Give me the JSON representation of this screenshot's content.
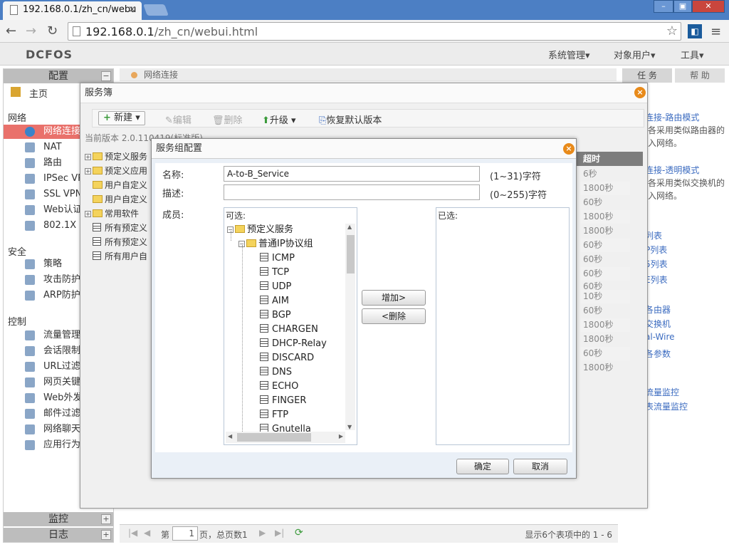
{
  "browser": {
    "tab_title": "192.168.0.1/zh_cn/webu",
    "tab_close": "×",
    "url_host": "192.168.0.1",
    "url_path": "/zh_cn/webui.html",
    "window_buttons": [
      "–",
      "▣",
      "✕"
    ]
  },
  "app": {
    "logo": "DCFOS",
    "top_menu": [
      "系统管理▾",
      "对象用户▾",
      "工具▾"
    ]
  },
  "sidebar": {
    "config_header": "配置",
    "home": "主页",
    "sections": {
      "network": "网络",
      "security": "安全",
      "control": "控制"
    },
    "network_items": [
      "网络连接",
      "NAT",
      "路由",
      "IPSec VPN",
      "SSL VPN",
      "Web认证",
      "802.1X"
    ],
    "security_items": [
      "策略",
      "攻击防护",
      "ARP防护"
    ],
    "control_items": [
      "流量管理",
      "会话限制",
      "URL过滤",
      "网页关键字",
      "Web外发",
      "邮件过滤",
      "网络聊天",
      "应用行为"
    ],
    "monitor_header": "监控",
    "log_header": "日志",
    "collapse_symbol": "−",
    "expand_symbol": "+"
  },
  "main": {
    "breadcrumb": "网络连接",
    "pager": {
      "prefix": "第",
      "page": "1",
      "suffix": "页，总页数1",
      "summary": "显示6个表项中的 1 - 6"
    }
  },
  "right_panel": {
    "tabs": [
      "任 务",
      "帮 助"
    ],
    "lines": [
      {
        "text": "连接-路由模式",
        "link": true
      },
      {
        "text": "各采用类似路由器的",
        "link": false
      },
      {
        "text": "入网络。",
        "link": false
      },
      {
        "text": "连接-透明模式",
        "link": true
      },
      {
        "text": "各采用类似交换机的",
        "link": false
      },
      {
        "text": "入网络。",
        "link": false
      },
      {
        "text": "列表",
        "link": true
      },
      {
        "text": "P列表",
        "link": true
      },
      {
        "text": "5列表",
        "link": true
      },
      {
        "text": "E列表",
        "link": true
      },
      {
        "text": "各由器",
        "link": true
      },
      {
        "text": "交换机",
        "link": true
      },
      {
        "text": "al-Wire",
        "link": true
      },
      {
        "text": "各参数",
        "link": true
      },
      {
        "text": "流量监控",
        "link": true
      },
      {
        "text": "表流量监控",
        "link": true
      }
    ]
  },
  "service_book": {
    "title": "服务簿",
    "toolbar": {
      "new": "新建",
      "edit": "编辑",
      "delete": "删除",
      "upgrade": "升级",
      "restore": "恢复默认版本"
    },
    "version": "当前版本 2.0.110419(标准版)",
    "tree": [
      "预定义服务",
      "预定义应用",
      "用户自定义",
      "用户自定义",
      "常用软件",
      "所有预定义",
      "所有预定义",
      "所有用户自"
    ],
    "grid_header": "超时",
    "grid_values": [
      "6秒",
      "1800秒",
      "60秒",
      "1800秒",
      "1800秒",
      "60秒",
      "60秒",
      "60秒",
      "60秒",
      "10秒",
      "60秒",
      "1800秒",
      "1800秒",
      "60秒",
      "1800秒"
    ]
  },
  "group_dialog": {
    "title": "服务组配置",
    "name_label": "名称:",
    "name_value": "A-to-B_Service",
    "name_hint": "(1~31)字符",
    "desc_label": "描述:",
    "desc_value": "",
    "desc_hint": "(0~255)字符",
    "members_label": "成员:",
    "available_label": "可选:",
    "selected_label": "已选:",
    "tree_root": "预定义服务",
    "tree_group": "普通IP协议组",
    "services": [
      "ICMP",
      "TCP",
      "UDP",
      "AIM",
      "BGP",
      "CHARGEN",
      "DHCP-Relay",
      "DISCARD",
      "DNS",
      "ECHO",
      "FINGER",
      "FTP",
      "Gnutella"
    ],
    "add_button": "增加>",
    "remove_button": "<删除",
    "ok_button": "确定",
    "cancel_button": "取消"
  }
}
